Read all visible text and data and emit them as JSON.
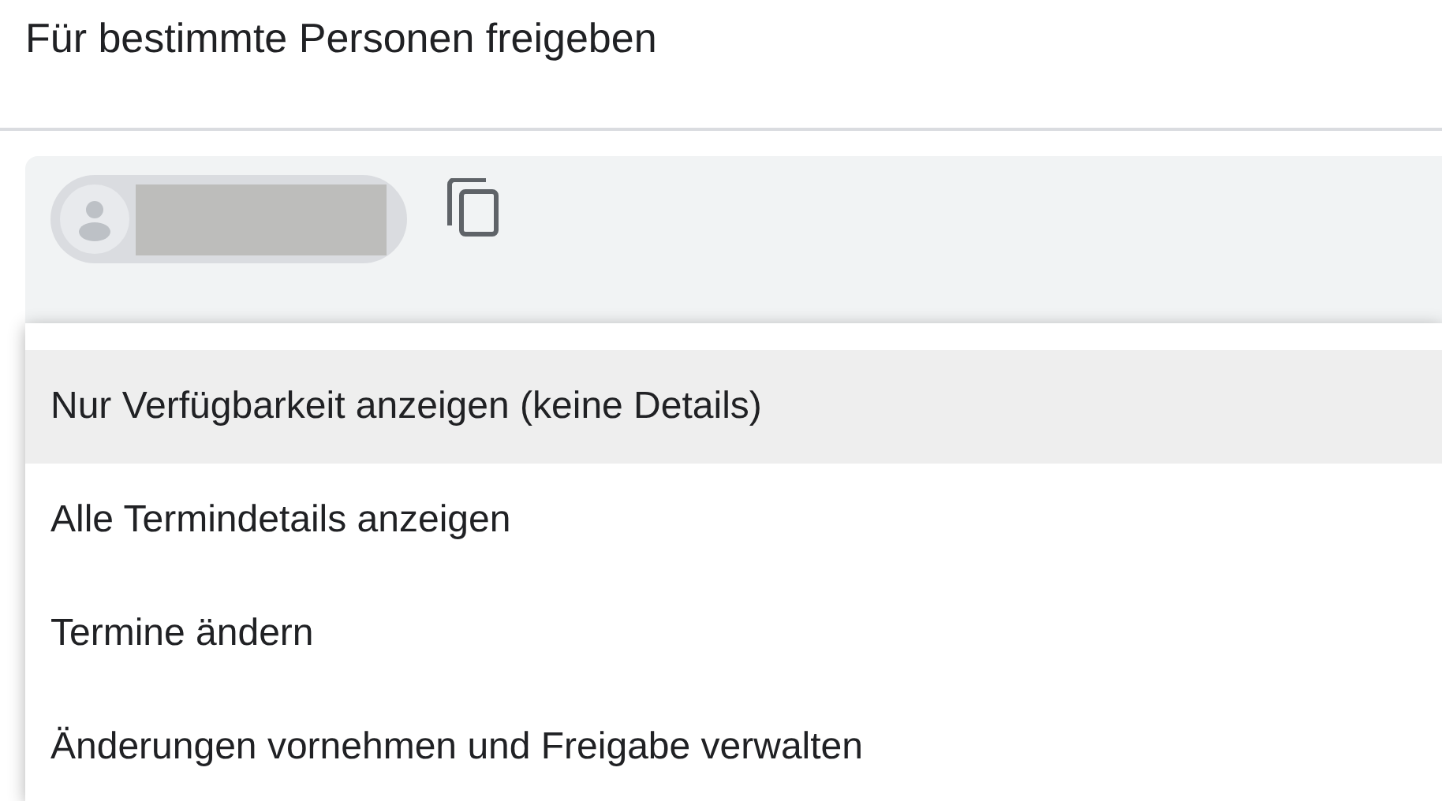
{
  "dialog": {
    "title": "Für bestimmte Personen freigeben"
  },
  "menu": {
    "items": [
      {
        "label": "Nur Verfügbarkeit anzeigen (keine Details)",
        "selected": true
      },
      {
        "label": "Alle Termindetails anzeigen",
        "selected": false
      },
      {
        "label": "Termine ändern",
        "selected": false
      },
      {
        "label": "Änderungen vornehmen und Freigabe verwalten",
        "selected": false
      }
    ]
  }
}
